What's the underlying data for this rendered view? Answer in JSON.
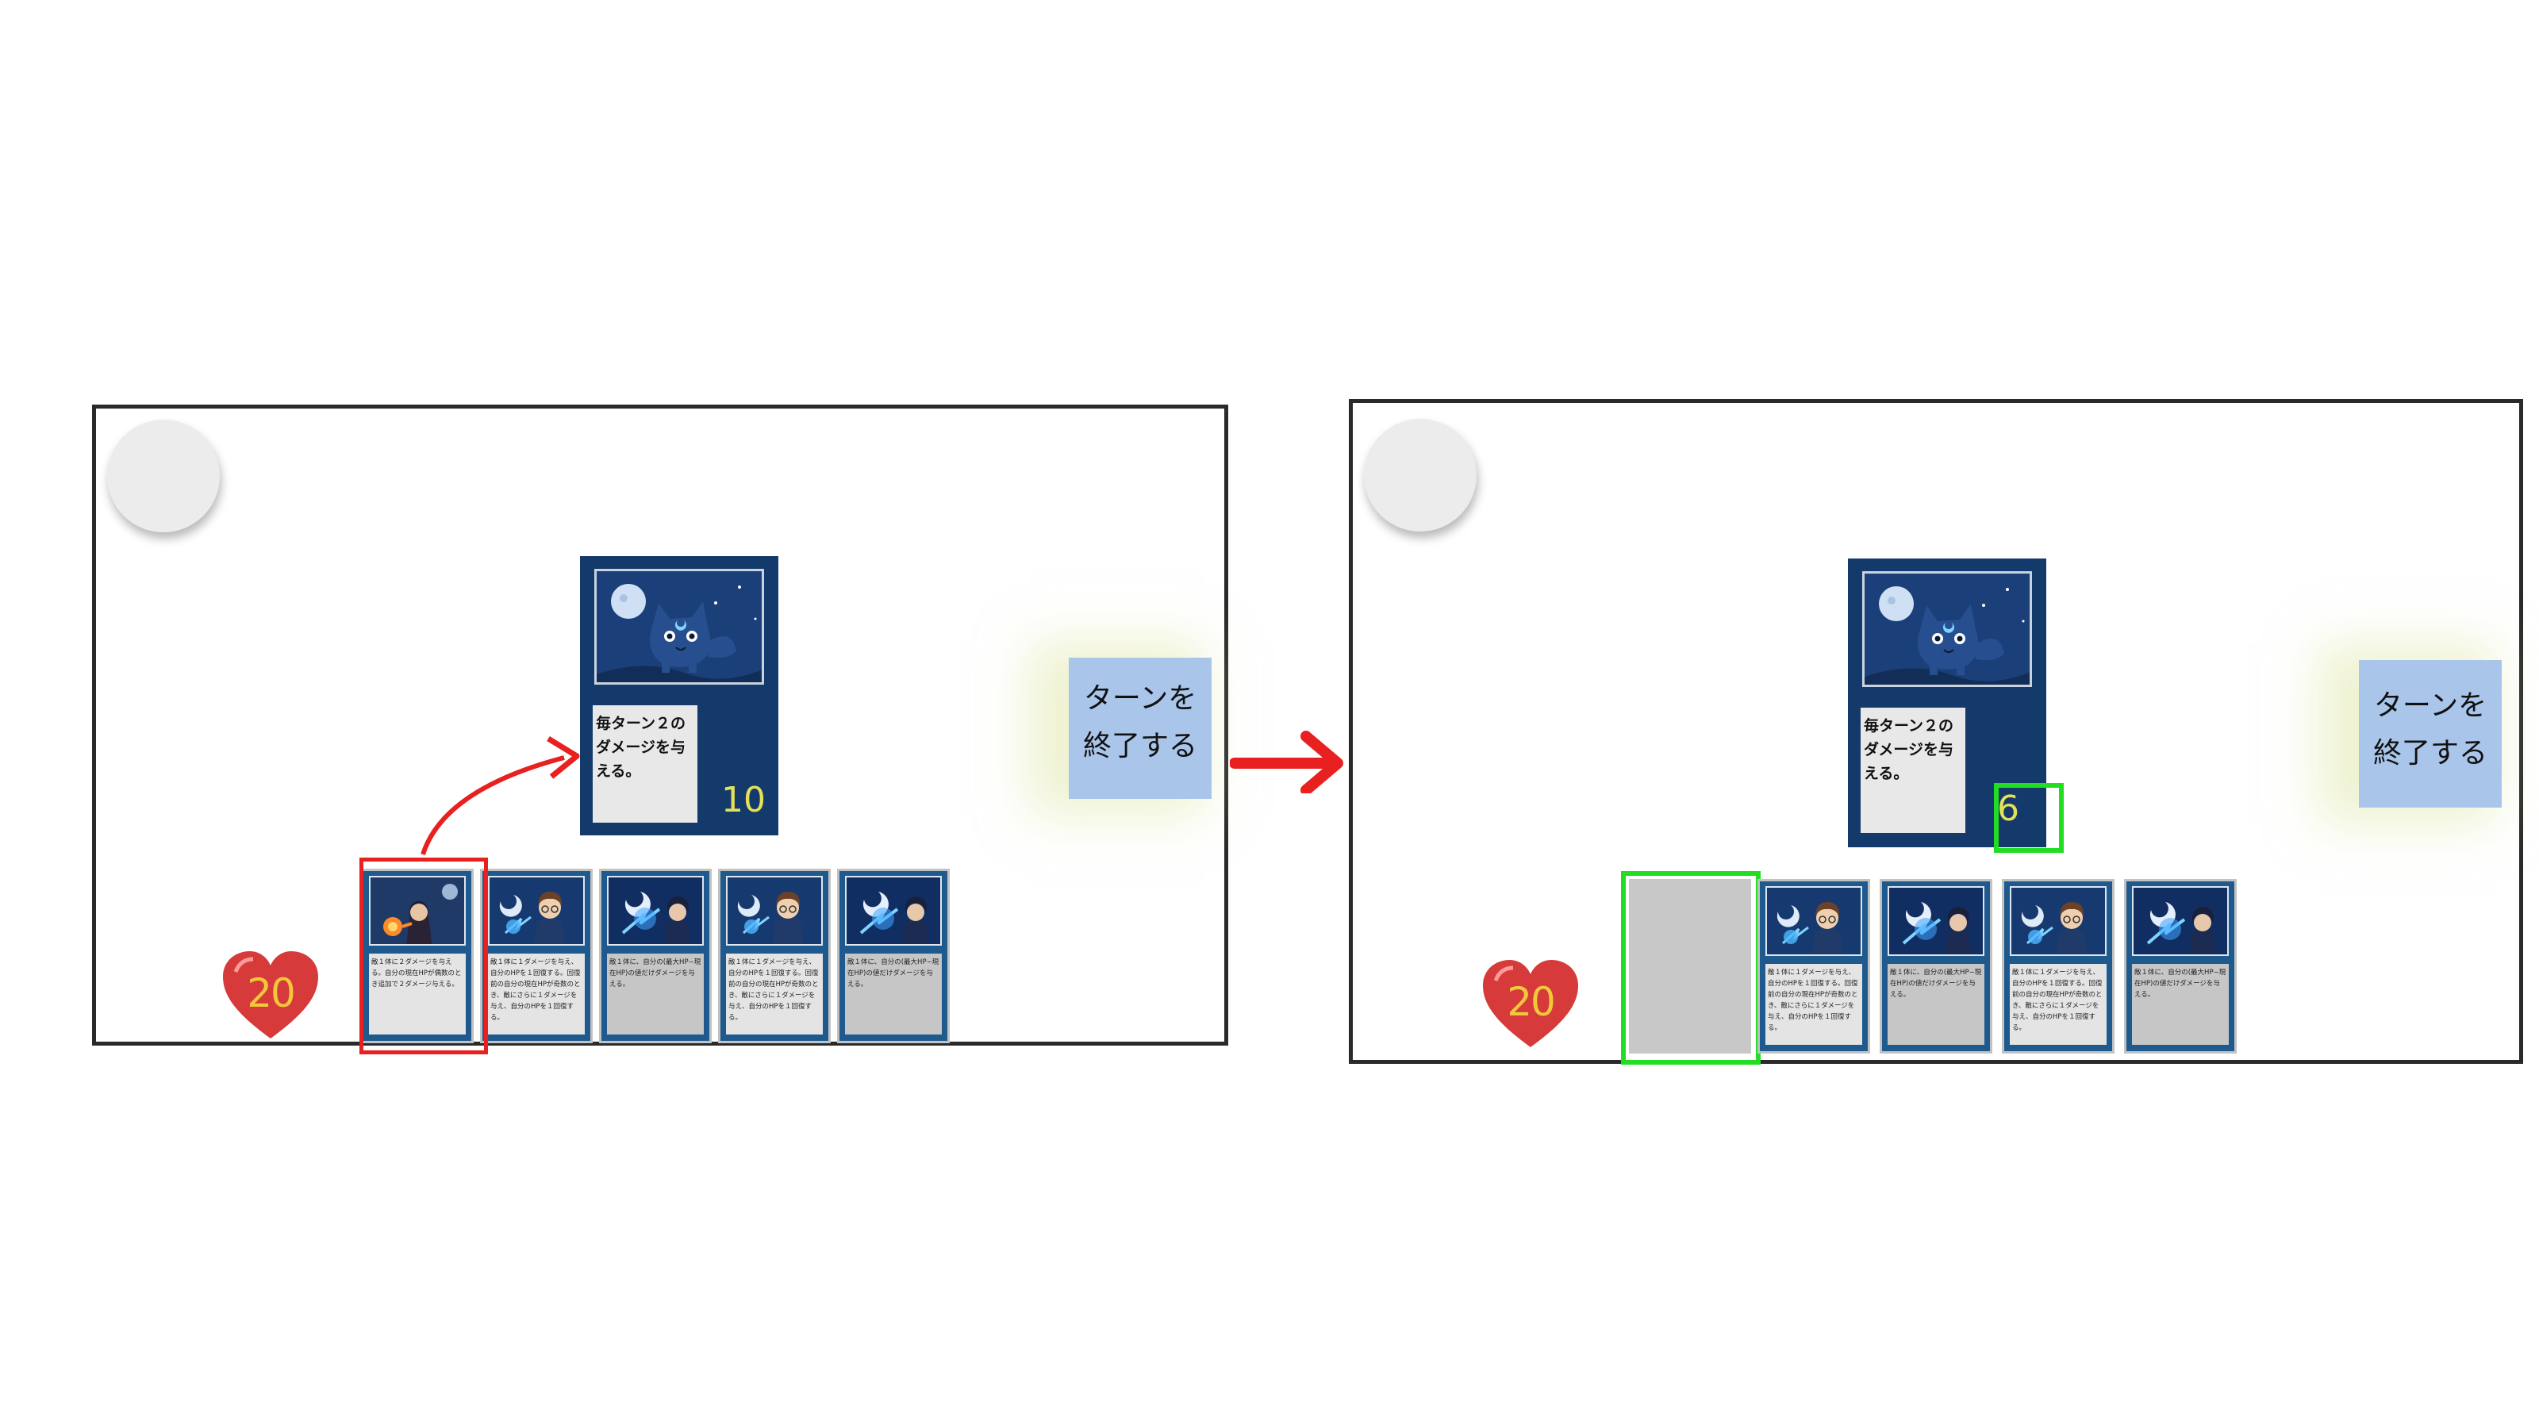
{
  "colors": {
    "card_bg": "#143a6b",
    "hand_card_bg": "#1e5a8e",
    "end_turn_button": "#a9c6ea",
    "heart": "#d63a3a",
    "hp_number": "#f1c83a",
    "enemy_hp_number_before": "#e4e05a",
    "enemy_hp_number_after": "#e4e05a",
    "highlight_selected": "#e82020",
    "highlight_result": "#22dd22",
    "transition_arrow": "#e82020"
  },
  "icons": {
    "player_avatar": "avatar-placeholder-icon",
    "player_hp": "heart-icon",
    "enemy_art": "moon-wolf-art",
    "transition": "right-arrow-icon",
    "play_card": "curved-arrow-icon"
  },
  "before": {
    "enemy": {
      "text": "毎ターン２の\nダメージを与\nえる。",
      "hp": "10"
    },
    "end_turn_label": "ターンを\n終了する",
    "player_hp": "20",
    "hand": [
      {
        "art": "dark-mage-art",
        "text": "敵１体に２ダメージを与える。自分の現在HPが偶数のとき追加で２ダメージ与える。",
        "shade": "light"
      },
      {
        "art": "blue-mage-boy-art",
        "text": "敵１体に１ダメージを与え、自分のHPを１回復する。回復前の自分の現在HPが奇数のとき、敵にさらに１ダメージを与え、自分のHPを１回復する。",
        "shade": "light"
      },
      {
        "art": "moon-sorcerer-art",
        "text": "敵１体に、自分の(最大HP−現在HP)の値だけダメージを与える。",
        "shade": "dark"
      },
      {
        "art": "blue-mage-boy-art",
        "text": "敵１体に１ダメージを与え、自分のHPを１回復する。回復前の自分の現在HPが奇数のとき、敵にさらに１ダメージを与え、自分のHPを１回復する。",
        "shade": "light"
      },
      {
        "art": "moon-sorcerer-art",
        "text": "敵１体に、自分の(最大HP−現在HP)の値だけダメージを与える。",
        "shade": "dark"
      }
    ]
  },
  "after": {
    "enemy": {
      "text": "毎ターン２の\nダメージを与\nえる。",
      "hp": "6"
    },
    "end_turn_label": "ターンを\n終了する",
    "player_hp": "20",
    "hand": [
      {
        "art": "blue-mage-boy-art",
        "text": "敵１体に１ダメージを与え、自分のHPを１回復する。回復前の自分の現在HPが奇数のとき、敵にさらに１ダメージを与え、自分のHPを１回復する。",
        "shade": "light"
      },
      {
        "art": "moon-sorcerer-art",
        "text": "敵１体に、自分の(最大HP−現在HP)の値だけダメージを与える。",
        "shade": "dark"
      },
      {
        "art": "blue-mage-boy-art",
        "text": "敵１体に１ダメージを与え、自分のHPを１回復する。回復前の自分の現在HPが奇数のとき、敵にさらに１ダメージを与え、自分のHPを１回復する。",
        "shade": "light"
      },
      {
        "art": "moon-sorcerer-art",
        "text": "敵１体に、自分の(最大HP−現在HP)の値だけダメージを与える。",
        "shade": "dark"
      }
    ]
  }
}
